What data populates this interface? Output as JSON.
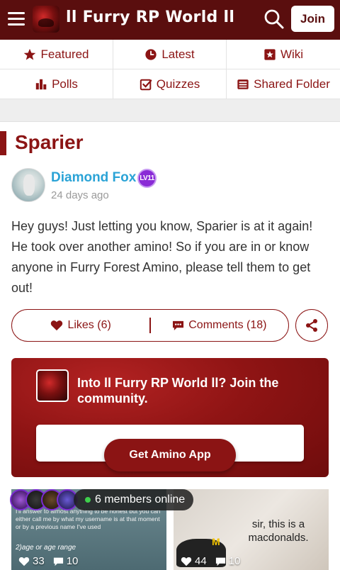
{
  "header": {
    "title": "ll Furry RP World ll",
    "join_label": "Join",
    "menu_icon": "hamburger-icon",
    "search_icon": "search-icon",
    "bg_color": "#5a0e0e"
  },
  "nav": {
    "items": [
      {
        "label": "Featured",
        "icon": "star-icon"
      },
      {
        "label": "Latest",
        "icon": "clock-icon"
      },
      {
        "label": "Wiki",
        "icon": "wiki-icon"
      },
      {
        "label": "Polls",
        "icon": "poll-icon"
      },
      {
        "label": "Quizzes",
        "icon": "checkbox-icon"
      },
      {
        "label": "Shared Folder",
        "icon": "folder-icon"
      }
    ],
    "accent": "#8b1414"
  },
  "post": {
    "title": "Sparier",
    "author": "Diamond Fox",
    "level": "LV11",
    "time": "24 days ago",
    "body": "Hey guys! Just letting you know, Sparier is at it again! He took over another amino! So if you are in or know anyone in Furry Forest Amino, please tell them to get out!",
    "likes_label": "Likes (6)",
    "comments_label": "Comments (18)"
  },
  "banner": {
    "text": "Into ll Furry RP World ll? Join the community.",
    "button_label": "Get Amino App"
  },
  "online": {
    "label": "6 members online"
  },
  "feed": [
    {
      "text": "I'll answer to almost anything to be honest but you can either call me by what my username is at that moment or by a previous name I've used",
      "subtext": "2)age or age range",
      "likes": "33",
      "comments": "10"
    },
    {
      "text": "sir, this is a macdonalds.",
      "likes": "44",
      "comments": "10"
    }
  ]
}
